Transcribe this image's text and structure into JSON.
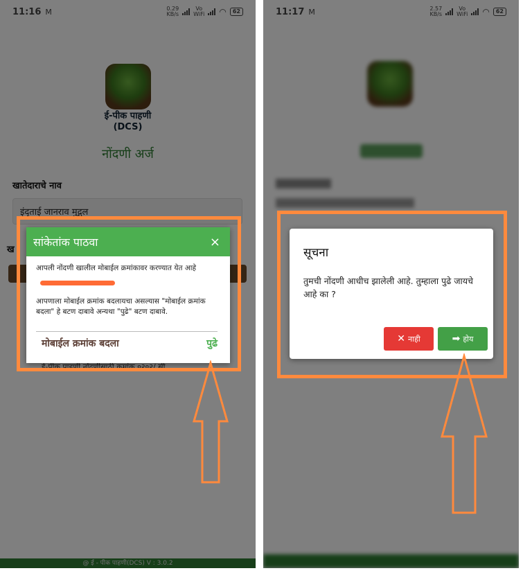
{
  "left_screen": {
    "status": {
      "time": "11:16",
      "mail_icon": "M",
      "speed": "0.29\nKB/s",
      "network": "Vo\nWiFi",
      "battery": "62"
    },
    "app_name_line1": "ई-पीक पाहणी",
    "app_name_line2": "(DCS)",
    "form_title": "नोंदणी अर्ज",
    "field_label": "खातेदाराचे नाव",
    "field_value": "इंद्ताई जानराव मुद्गल",
    "field_label_2": "ख",
    "behind_text": "ई-पीक पाहणी नोंदणीसाठी क्रमांक ०२०२/ सी",
    "footer": "@ ई - पीक पाहणी(DCS) V : 3.0.2",
    "dialog": {
      "title": "सांकेतांक पाठवा",
      "close_icon": "×",
      "message1": "आपली नोंदणी खालील मोबाईल क्रमांकावर करण्यात येत आहे",
      "message2": "आपणाला मोबाईल क्रमांक बदलायचा असल्यास \"मोबाईल क्रमांक बदला\" हे बटण दाबावे अन्यथा \"पुढे\" बटण दाबावे.",
      "change_button": "मोबाईल क्रमांक बदला",
      "next_button": "पुढे"
    }
  },
  "right_screen": {
    "status": {
      "time": "11:17",
      "mail_icon": "M",
      "speed": "2.57\nKB/s",
      "network": "Vo\nWiFi",
      "battery": "62"
    },
    "dialog": {
      "title": "सूचना",
      "message": "तुमची नोंदणी आधीच झालेली आहे. तुम्हाला पुढे जायचे आहे का ?",
      "no_icon": "✕",
      "no_button": "नाही",
      "yes_icon": "➡",
      "yes_button": "होय"
    }
  },
  "colors": {
    "annotation": "#ff8a3d",
    "dialog_header": "#4caf50",
    "no_button": "#e53935",
    "yes_button": "#43a047"
  }
}
